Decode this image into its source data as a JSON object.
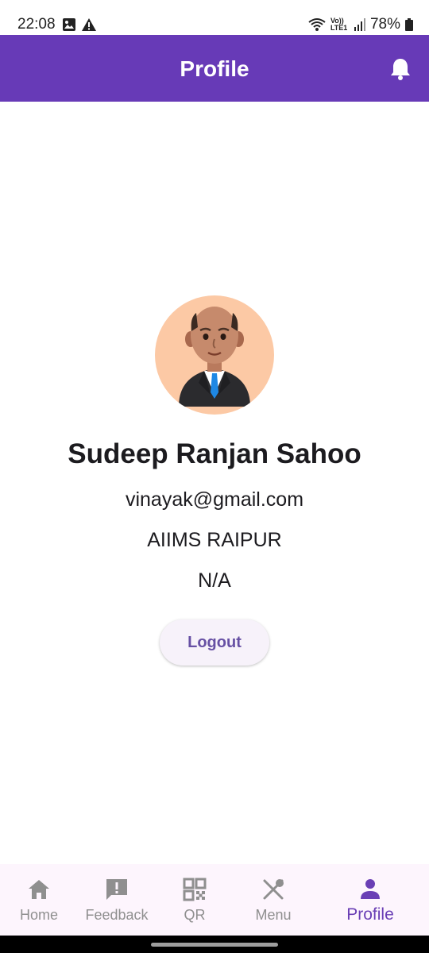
{
  "status_bar": {
    "time": "22:08",
    "network": "Vo)) LTE1",
    "battery": "78%"
  },
  "app_bar": {
    "title": "Profile",
    "color": "#673ab7"
  },
  "profile": {
    "name": "Sudeep Ranjan Sahoo",
    "email": "vinayak@gmail.com",
    "organization": "AIIMS RAIPUR",
    "extra": "N/A",
    "avatar_icon": "businessman-avatar"
  },
  "actions": {
    "logout_label": "Logout"
  },
  "bottom_nav": {
    "items": [
      {
        "label": "Home",
        "icon": "home-icon"
      },
      {
        "label": "Feedback",
        "icon": "feedback-icon"
      },
      {
        "label": "QR",
        "icon": "qr-code-icon"
      },
      {
        "label": "Menu",
        "icon": "restaurant-menu-icon"
      },
      {
        "label": "Profile",
        "icon": "person-icon",
        "active": true
      }
    ],
    "active_color": "#6a3fb5",
    "inactive_color": "#8f8f8f"
  }
}
